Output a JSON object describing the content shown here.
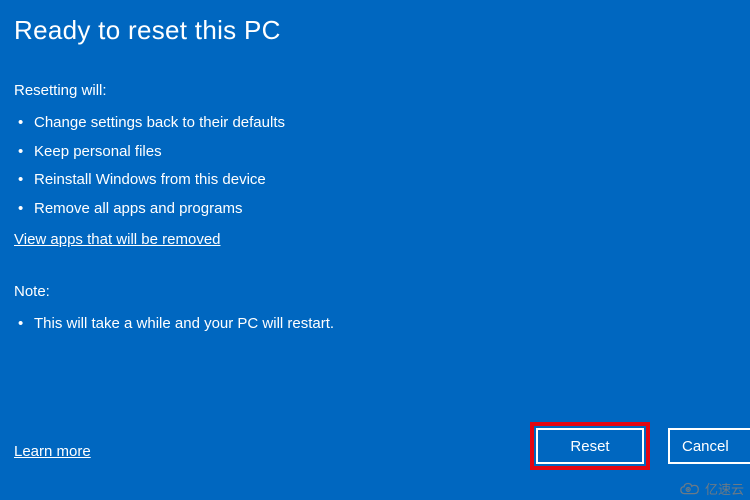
{
  "title": "Ready to reset this PC",
  "sections": {
    "resetting_label": "Resetting will:",
    "resetting_items": [
      "Change settings back to their defaults",
      "Keep personal files",
      "Reinstall Windows from this device",
      "Remove all apps and programs"
    ],
    "view_apps_link": "View apps that will be removed",
    "note_label": "Note:",
    "note_items": [
      "This will take a while and your PC will restart."
    ]
  },
  "footer": {
    "learn_more": "Learn more",
    "reset_button": "Reset",
    "cancel_button": "Cancel"
  },
  "watermark": {
    "text": "亿速云"
  },
  "colors": {
    "background": "#0067c0",
    "text": "#ffffff",
    "highlight_border": "#e30613"
  }
}
